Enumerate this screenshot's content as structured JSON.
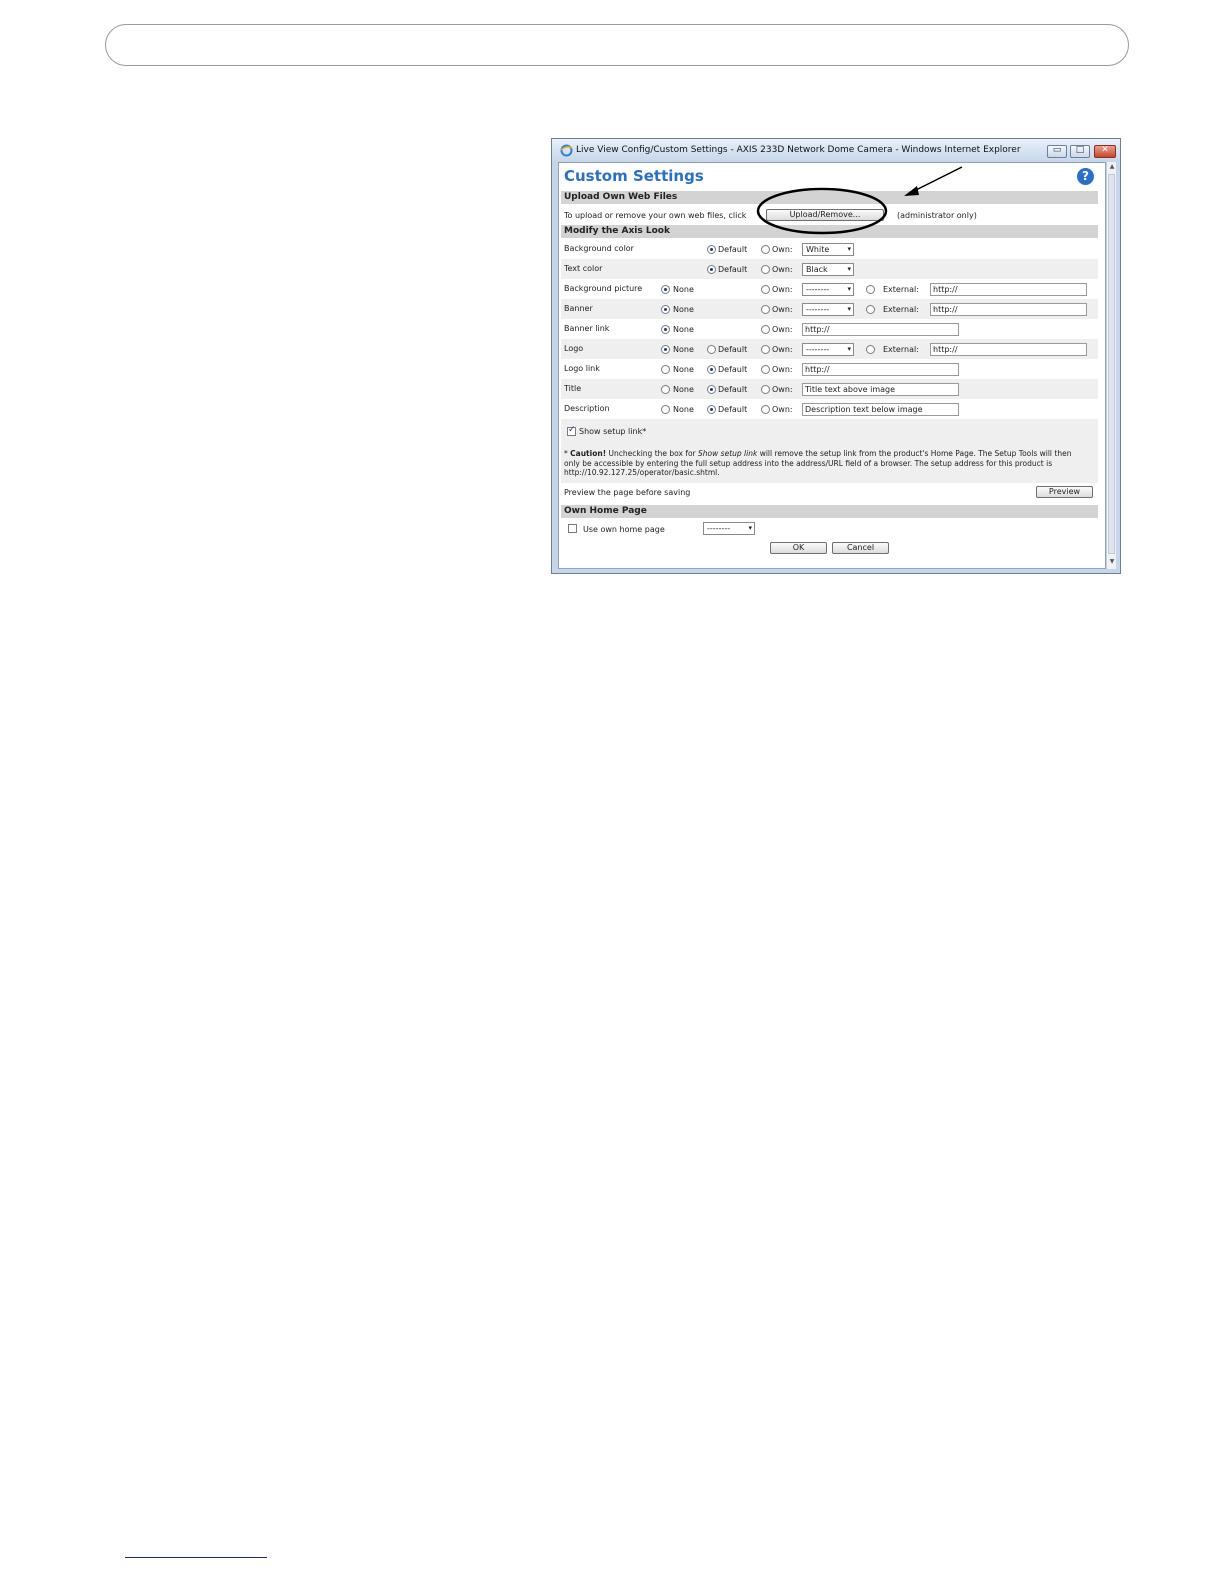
{
  "window": {
    "title": "Live View Config/Custom Settings - AXIS 233D Network Dome Camera - Windows Internet Explorer",
    "minimize_glyph": "▭",
    "maximize_glyph": "□",
    "close_glyph": "✕"
  },
  "page": {
    "title": "Custom Settings",
    "help_glyph": "?"
  },
  "upload_section": {
    "heading": "Upload Own Web Files",
    "text_before": "To upload or remove your own web files, click",
    "button_label": "Upload/Remove...",
    "text_after": "(administrator only)"
  },
  "look_section": {
    "heading": "Modify the Axis Look",
    "option_none": "None",
    "option_default": "Default",
    "option_own": "Own:",
    "option_external": "External:",
    "rows": {
      "background_color": {
        "label": "Background color",
        "own_value": "White",
        "selected": "Default"
      },
      "text_color": {
        "label": "Text color",
        "own_value": "Black",
        "selected": "Default"
      },
      "background_picture": {
        "label": "Background picture",
        "own_value": "--------",
        "external_value": "http://",
        "selected": "None"
      },
      "banner": {
        "label": "Banner",
        "own_value": "--------",
        "external_value": "http://",
        "selected": "None"
      },
      "banner_link": {
        "label": "Banner link",
        "own_value": "http://",
        "selected": "None"
      },
      "logo": {
        "label": "Logo",
        "own_value": "--------",
        "external_value": "http://",
        "selected": "None"
      },
      "logo_link": {
        "label": "Logo link",
        "own_value": "http://",
        "selected": "Default"
      },
      "title": {
        "label": "Title",
        "own_value": "Title text above image",
        "selected": "Default"
      },
      "description": {
        "label": "Description",
        "own_value": "Description text below image",
        "selected": "Default"
      }
    },
    "show_setup_link": {
      "label": "Show setup link*",
      "checked": true
    },
    "caution": {
      "star": "*",
      "bold": "Caution!",
      "text_1": "Unchecking the box for",
      "italic": "Show setup link",
      "text_2": "will remove the setup link from the product's Home Page. The Setup Tools will then only be accessible by entering the full setup address into the address/URL field of a browser. The setup address for this product is http://10.92.127.25/operator/basic.shtml."
    },
    "preview_text": "Preview the page before saving",
    "preview_button": "Preview"
  },
  "home_section": {
    "heading": "Own Home Page",
    "checkbox_label": "Use own home page",
    "checked": false,
    "select_value": "--------"
  },
  "footer_buttons": {
    "ok": "OK",
    "cancel": "Cancel"
  },
  "arrow_glyph": "▾",
  "scroll_up": "▲",
  "scroll_down": "▼",
  "colors": {
    "title_blue": "#2a6fcc",
    "section_gray": "#d3d3d3"
  }
}
